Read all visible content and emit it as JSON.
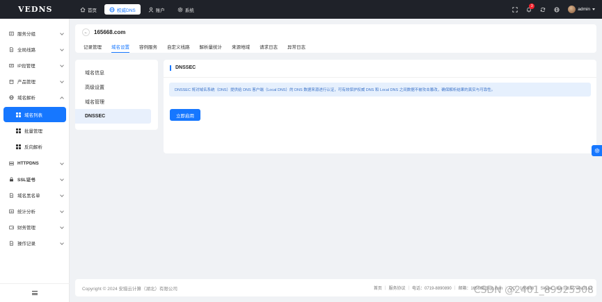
{
  "brand": "VEDNS",
  "topnav": [
    {
      "label": "首页",
      "icon": "home-icon"
    },
    {
      "label": "权威DNS",
      "icon": "globe-icon",
      "active": true
    },
    {
      "label": "账户",
      "icon": "user-icon"
    },
    {
      "label": "系统",
      "icon": "gear-icon"
    }
  ],
  "header_right": {
    "notification_count": "3",
    "username": "admin"
  },
  "sidebar": {
    "items": [
      {
        "label": "服务分组"
      },
      {
        "label": "全局线路"
      },
      {
        "label": "IP段管理"
      },
      {
        "label": "产品管理"
      },
      {
        "label": "域名解析"
      },
      {
        "label": "HTTPDNS"
      },
      {
        "label": "SSL证书"
      },
      {
        "label": "域名黑名单"
      },
      {
        "label": "统计分析"
      },
      {
        "label": "财务管理"
      },
      {
        "label": "操作记录"
      }
    ],
    "sub_items": [
      {
        "label": "域名列表"
      },
      {
        "label": "批量管理"
      },
      {
        "label": "反向解析"
      }
    ]
  },
  "page": {
    "domain": "165668.com",
    "tabs": [
      "记录管理",
      "域名设置",
      "容例服务",
      "自定义线路",
      "解析量统计",
      "来源地域",
      "请求日志",
      "异常日志"
    ],
    "active_tab": "域名设置"
  },
  "left_menu": [
    "域名信息",
    "高级设置",
    "域名管理",
    "DNSSEC"
  ],
  "section": {
    "title": "DNSSEC",
    "info": "DNSSEC 将对域名系统（DNS）提供给 DNS 客户端（Local DNS）的 DNS 数据来源进行认证，可有效保护权威 DNS 和 Local DNS 之间数据不被攻击篡改，确保解析结果的真实与可靠性。",
    "button": "立即启用"
  },
  "footer": {
    "copyright": "Copyright © 2024 安猎云计算（湖北）有限公司",
    "links": [
      "首页",
      "服务协议",
      "电话：0719-8890890",
      "邮箱：165668@qq.com",
      "QQ：165668",
      "Skype：live:cid.5f7e0a31a1"
    ]
  },
  "watermark": "CSDN @2401_89925308",
  "colors": {
    "accent": "#1677ff",
    "topbar": "#1f2229"
  }
}
